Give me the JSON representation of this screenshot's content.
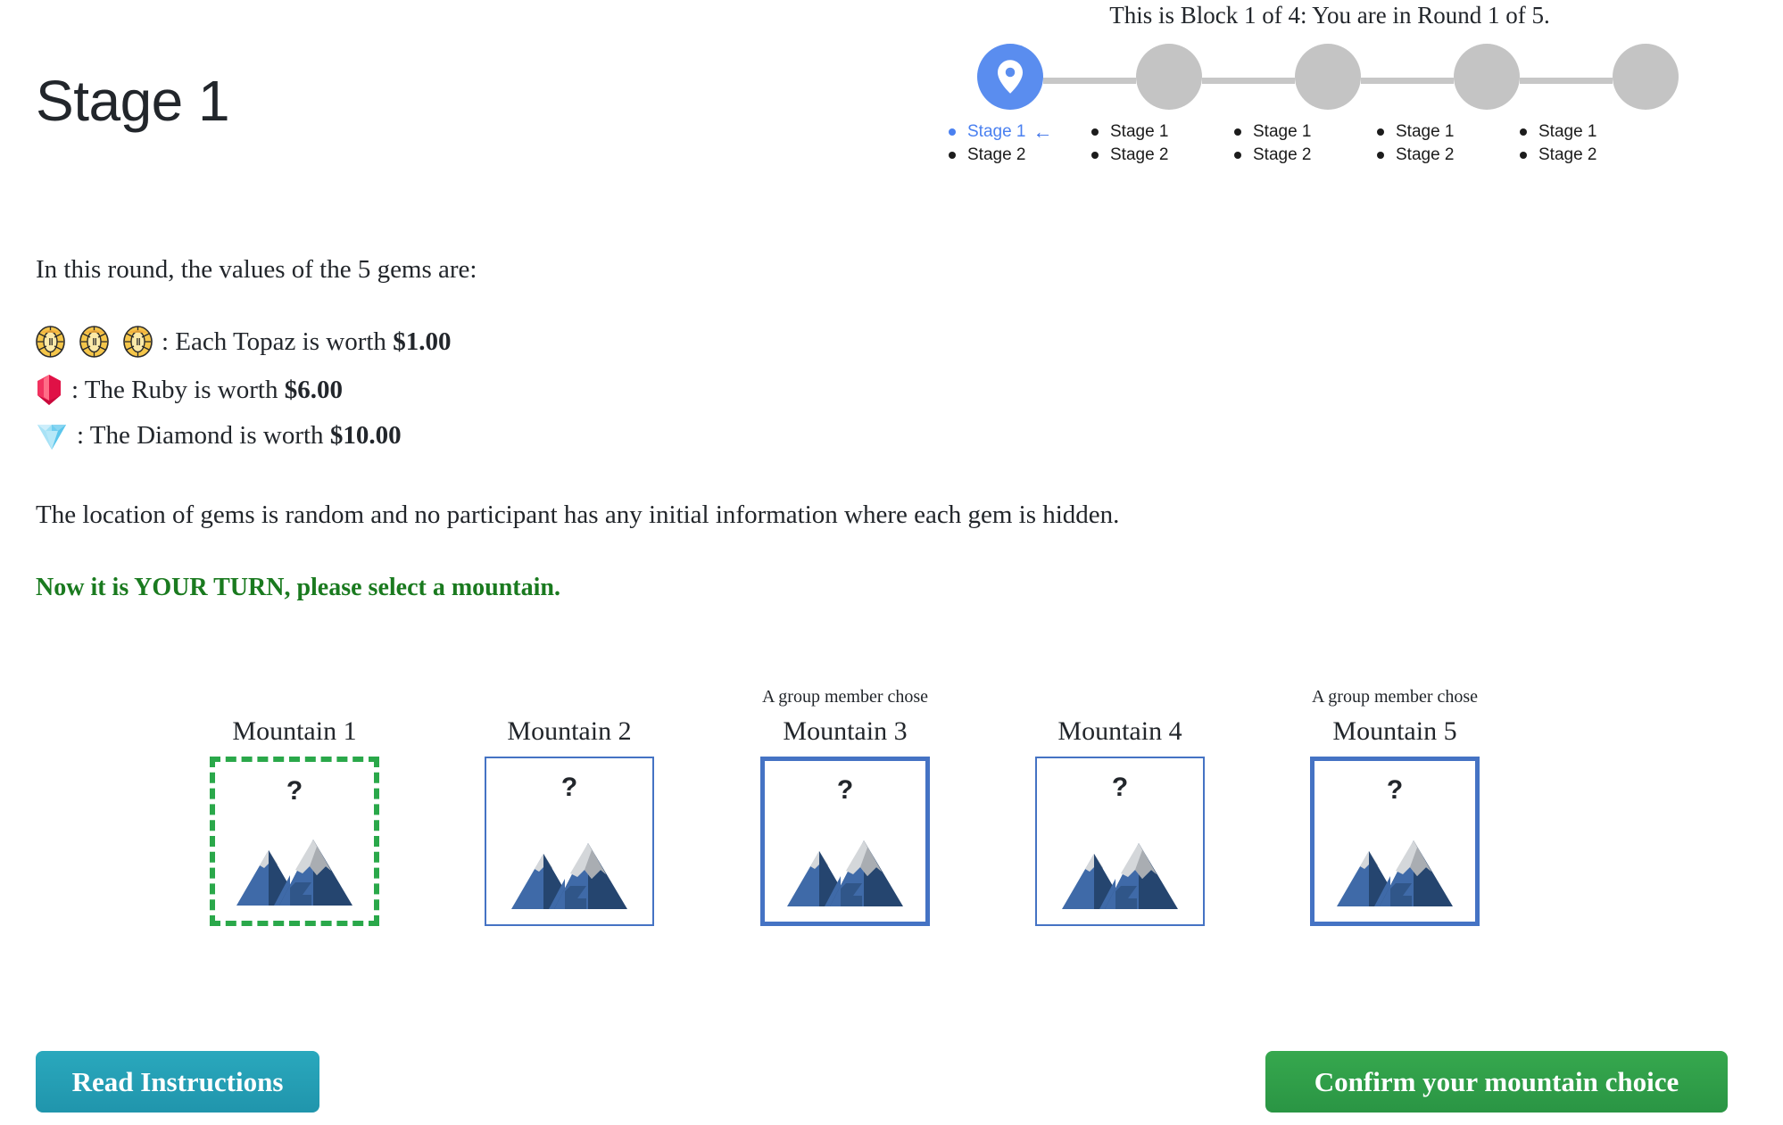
{
  "page": {
    "title": "Stage 1"
  },
  "stepper": {
    "caption": "This is Block 1 of 4: You are in Round 1 of 5.",
    "active_index": 0,
    "active_color": "#5a8def",
    "inactive_color": "#c4c4c4",
    "line_color": "#c7c7c7",
    "pin_icon": "location-pin-icon",
    "current_arrow": "←",
    "nodes": [
      {
        "stage1": "Stage 1",
        "stage2": "Stage 2",
        "current": true
      },
      {
        "stage1": "Stage 1",
        "stage2": "Stage 2",
        "current": false
      },
      {
        "stage1": "Stage 1",
        "stage2": "Stage 2",
        "current": false
      },
      {
        "stage1": "Stage 1",
        "stage2": "Stage 2",
        "current": false
      },
      {
        "stage1": "Stage 1",
        "stage2": "Stage 2",
        "current": false
      }
    ]
  },
  "content": {
    "intro": "In this round, the values of the 5 gems are:",
    "gems": [
      {
        "icon": "topaz-gem-icon",
        "icon_count": 3,
        "label_prefix": ": Each Topaz is worth ",
        "value": "$1.00"
      },
      {
        "icon": "ruby-gem-icon",
        "icon_count": 1,
        "label_prefix": ": The Ruby is worth ",
        "value": "$6.00"
      },
      {
        "icon": "diamond-gem-icon",
        "icon_count": 1,
        "label_prefix": ": The Diamond is worth ",
        "value": "$10.00"
      }
    ],
    "random_note": "The location of gems is random and no participant has any initial information where each gem is hidden.",
    "your_turn": "Now it is YOUR TURN, please select a mountain.",
    "your_turn_color": "#1a7a1f"
  },
  "mountains": {
    "group_chose_label": "A group member chose",
    "hidden_marker": "?",
    "selected_border_color": "#2aa84a",
    "card_border_color": "#4573c4",
    "items": [
      {
        "title": "Mountain 1",
        "state": "selected",
        "group_chose": false,
        "marker": "?"
      },
      {
        "title": "Mountain 2",
        "state": "plain",
        "group_chose": false,
        "marker": "?"
      },
      {
        "title": "Mountain 3",
        "state": "groupchose",
        "group_chose": true,
        "marker": "?"
      },
      {
        "title": "Mountain 4",
        "state": "plain",
        "group_chose": false,
        "marker": "?"
      },
      {
        "title": "Mountain 5",
        "state": "groupchose",
        "group_chose": true,
        "marker": "?"
      }
    ]
  },
  "footer": {
    "read_instructions_label": "Read Instructions",
    "read_instructions_color": "#2297ae",
    "confirm_label": "Confirm your mountain choice",
    "confirm_color": "#2e9e47"
  }
}
